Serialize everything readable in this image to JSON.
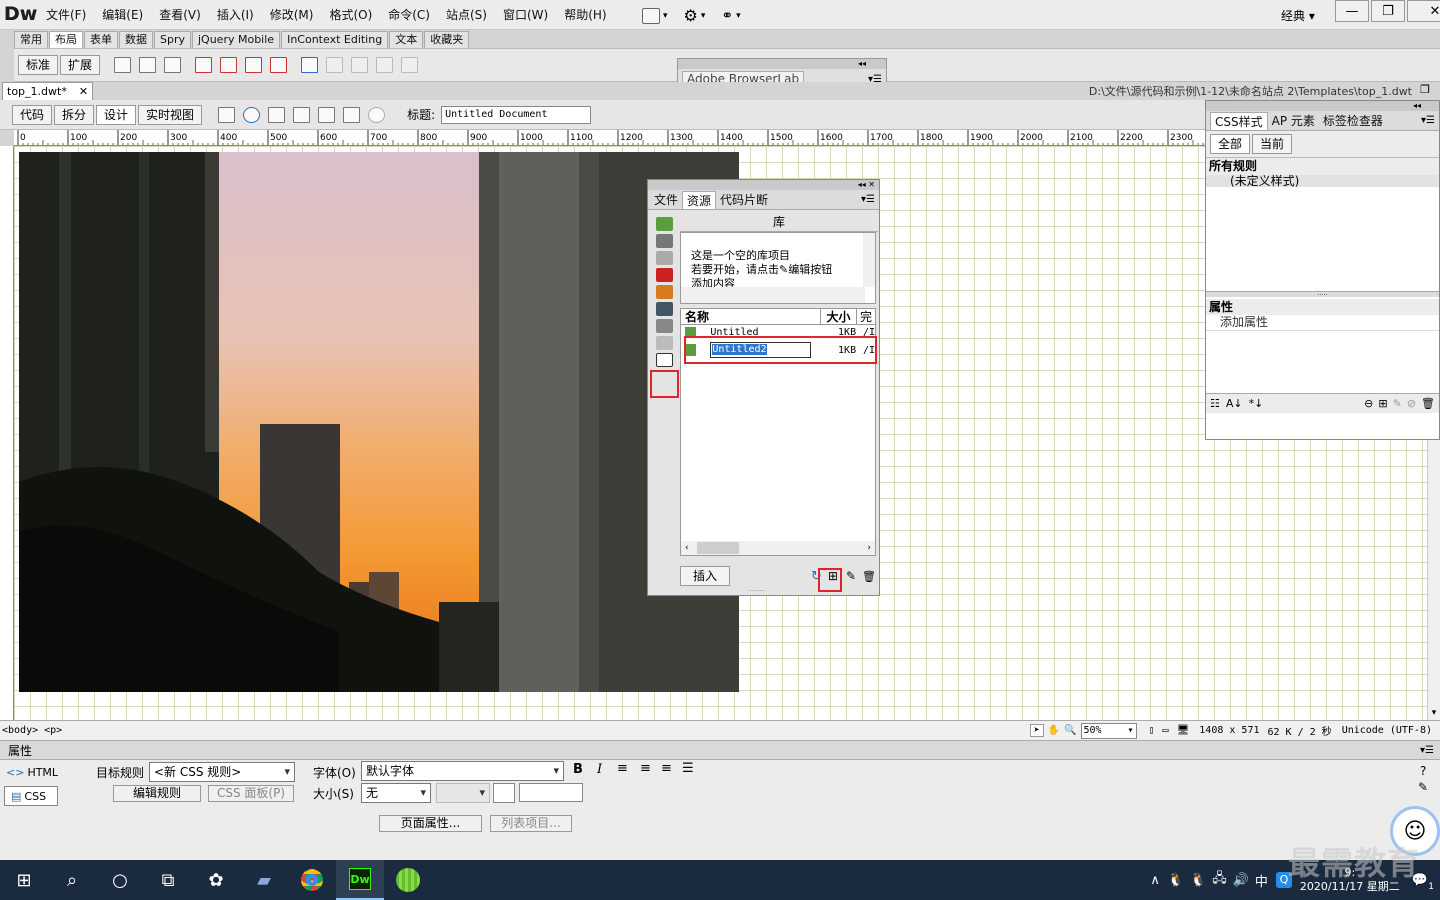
{
  "app": {
    "logo": "Dw",
    "menu": [
      "文件(F)",
      "编辑(E)",
      "查看(V)",
      "插入(I)",
      "修改(M)",
      "格式(O)",
      "命令(C)",
      "站点(S)",
      "窗口(W)",
      "帮助(H)"
    ],
    "workspace": "经典"
  },
  "insert_tabs": [
    "常用",
    "布局",
    "表单",
    "数据",
    "Spry",
    "jQuery Mobile",
    "InContext Editing",
    "文本",
    "收藏夹"
  ],
  "insert_selected": "布局",
  "layout_buttons": [
    "标准",
    "扩展"
  ],
  "browserlab": {
    "title": "Adobe BrowserLab"
  },
  "document": {
    "tab_name": "top_1.dwt*",
    "path": "D:\\文件\\源代码和示例\\1-12\\未命名站点 2\\Templates\\top_1.dwt",
    "views": [
      "代码",
      "拆分",
      "设计",
      "实时视图"
    ],
    "title_label": "标题:",
    "title_value": "Untitled Document"
  },
  "ruler": {
    "labels": [
      "0",
      "100",
      "200",
      "300",
      "400",
      "500",
      "600",
      "700",
      "800",
      "900",
      "1000",
      "1100",
      "1200",
      "1300",
      "1400",
      "1500",
      "1600",
      "1700",
      "1800",
      "1900",
      "2000",
      "2100",
      "2200",
      "2300"
    ]
  },
  "status": {
    "tags": "<body> <p>",
    "zoom": "50%",
    "dimensions": "1408 x 571",
    "size_time": "62 K / 2 秒",
    "encoding": "Unicode (UTF-8)"
  },
  "assets_panel": {
    "tabs": [
      "文件",
      "资源",
      "代码片断"
    ],
    "selected_tab": "资源",
    "header": "库",
    "preview_text": [
      "这是一个空的库项目",
      "若要开始，请点击",
      "编辑按钮",
      "添加内容"
    ],
    "columns": [
      "名称",
      "大小",
      "完"
    ],
    "rows": [
      {
        "name": "Untitled",
        "size": "1KB",
        "path": "/I"
      },
      {
        "name": "Untitled2",
        "size": "1KB",
        "path": "/I"
      }
    ],
    "insert_button": "插入"
  },
  "css_panel": {
    "tabs": [
      "CSS样式",
      "AP 元素",
      "标签检查器"
    ],
    "mode_buttons": [
      "全部",
      "当前"
    ],
    "rules_header": "所有规则",
    "rules_item": "(未定义样式)",
    "props_header": "属性",
    "add_property": "添加属性"
  },
  "properties": {
    "title": "属性",
    "html_tab": "HTML",
    "css_tab": "CSS",
    "target_rule_label": "目标规则",
    "target_rule_value": "<新 CSS 规则>",
    "edit_rule": "编辑规则",
    "css_panel_btn": "CSS 面板(P)",
    "font_label": "字体(O)",
    "font_value": "默认字体",
    "size_label": "大小(S)",
    "size_value": "无",
    "page_props": "页面属性...",
    "list_item": "列表项目..."
  },
  "taskbar": {
    "time": "9:",
    "date": "2020/11/17 星期二",
    "ime": "中",
    "notif_count": "1"
  },
  "watermark": "最需教育"
}
